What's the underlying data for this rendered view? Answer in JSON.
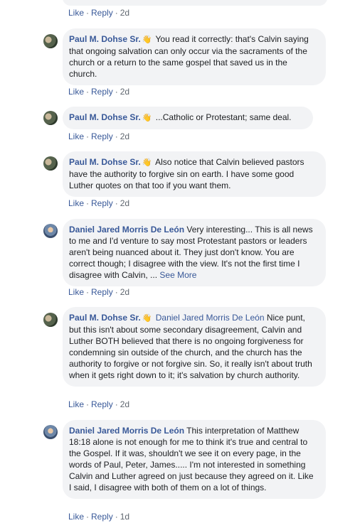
{
  "top": {
    "like": "Like",
    "reply": "Reply",
    "time": "2d"
  },
  "comments": [
    {
      "author": "Paul M. Dohse Sr.",
      "wave": "👋",
      "text": " You read it correctly: that's Calvin saying that ongoing salvation can only occur via the sacraments of the church or a return to the same gospel that saved us in the church.",
      "like": "Like",
      "reply": "Reply",
      "time": "2d"
    },
    {
      "author": "Paul M. Dohse Sr.",
      "wave": "👋",
      "text": " ...Catholic or Protestant; same deal.",
      "like": "Like",
      "reply": "Reply",
      "time": "2d"
    },
    {
      "author": "Paul M. Dohse Sr.",
      "wave": "👋",
      "text": " Also notice that Calvin believed pastors have the authority to forgive sin on earth. I have some good Luther quotes on that too if you want them.",
      "like": "Like",
      "reply": "Reply",
      "time": "2d"
    },
    {
      "author": "Daniel Jared Morris De León",
      "text": " Very interesting... This is all news to me and I'd venture to say most Protestant pastors or leaders aren't being nuanced about it. They just don't know. You are correct though; I disagree with the view. It's not the first time I disagree with Calvin, ...",
      "see_more": "See More",
      "like": "Like",
      "reply": "Reply",
      "time": "2d"
    },
    {
      "author": "Paul M. Dohse Sr.",
      "wave": "👋",
      "mention": "Daniel Jared Morris De León",
      "text": " Nice punt, but this isn't about some secondary disagreement, Calvin and Luther BOTH believed that there is no ongoing forgiveness for condemning sin outside of the church, and the church has the authority to forgive or not forgive sin. So, it really isn't about truth when it gets right down to it; it's salvation by church authority.",
      "like": "Like",
      "reply": "Reply",
      "time": "2d"
    },
    {
      "author": "Daniel Jared Morris De León",
      "text": " This interpretation of Matthew 18:18 alone is not enough for me to think it's true and central to the Gospel. If it was, shouldn't we see it on every page, in the words of Paul, Peter, James..... I'm not interested in something Calvin and Luther agreed on just because they agreed on it. Like I said, I disagree with both of them on a lot of things.",
      "like": "Like",
      "reply": "Reply",
      "time": "1d"
    }
  ]
}
